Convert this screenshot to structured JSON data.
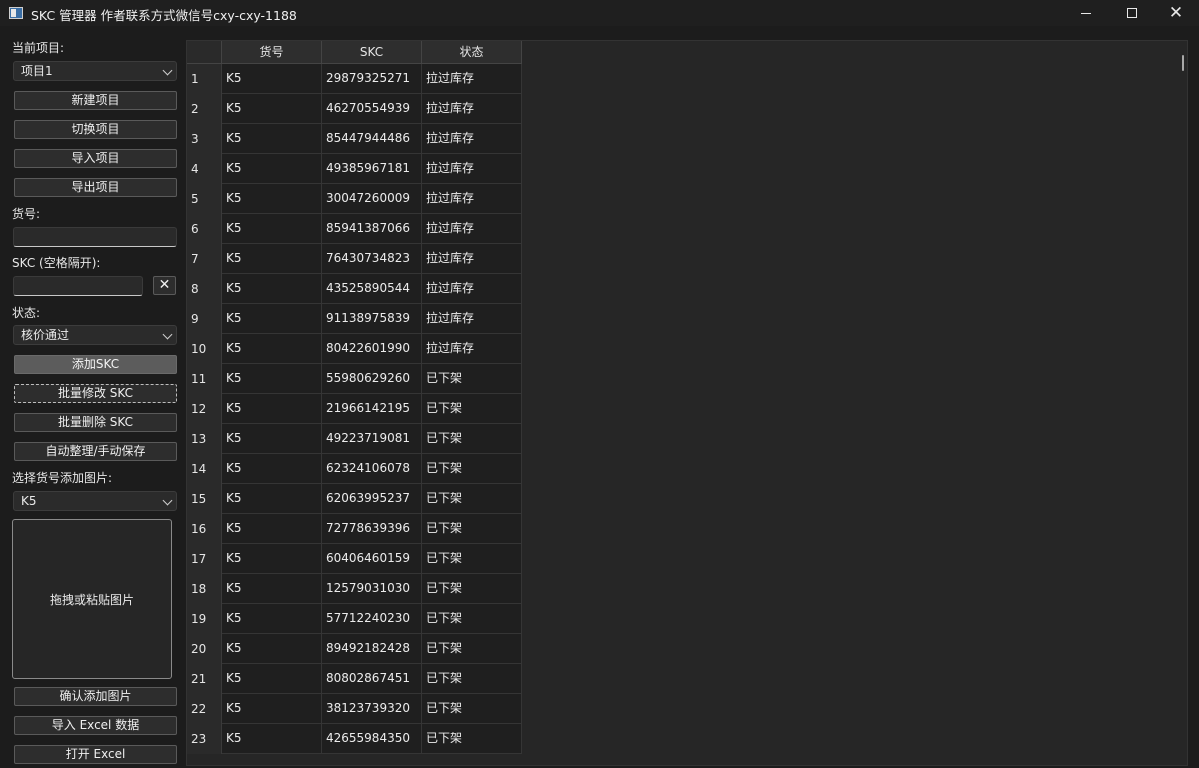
{
  "window": {
    "title": "SKC 管理器 作者联系方式微信号cxy-cxy-1188",
    "min_icon": "minimize-icon",
    "max_icon": "maximize-icon",
    "close_label": "✕"
  },
  "left": {
    "current_project_label": "当前项目:",
    "current_project_value": "项目1",
    "buttons": {
      "new_project": "新建项目",
      "switch_project": "切换项目",
      "import_project": "导入项目",
      "export_project": "导出项目"
    },
    "sku_label": "货号:",
    "sku_value": "",
    "skc_label": "SKC (空格隔开):",
    "skc_value": "",
    "clear_label": "✕",
    "status_label": "状态:",
    "status_value": "核价通过",
    "actions": {
      "add_skc": "添加SKC",
      "batch_modify": "批量修改 SKC",
      "batch_delete": "批量删除 SKC",
      "auto_organize": "自动整理/手动保存"
    },
    "image_sku_label": "选择货号添加图片:",
    "image_sku_value": "K5",
    "dropzone_text": "拖拽或粘贴图片",
    "bottom": {
      "confirm_image": "确认添加图片",
      "import_excel": "导入 Excel 数据",
      "open_excel": "打开 Excel"
    }
  },
  "table": {
    "columns": [
      "货号",
      "SKC",
      "状态"
    ],
    "rows": [
      {
        "n": "1",
        "sku": "K5",
        "skc": "29879325271",
        "status": "拉过库存"
      },
      {
        "n": "2",
        "sku": "K5",
        "skc": "46270554939",
        "status": "拉过库存"
      },
      {
        "n": "3",
        "sku": "K5",
        "skc": "85447944486",
        "status": "拉过库存"
      },
      {
        "n": "4",
        "sku": "K5",
        "skc": "49385967181",
        "status": "拉过库存"
      },
      {
        "n": "5",
        "sku": "K5",
        "skc": "30047260009",
        "status": "拉过库存"
      },
      {
        "n": "6",
        "sku": "K5",
        "skc": "85941387066",
        "status": "拉过库存"
      },
      {
        "n": "7",
        "sku": "K5",
        "skc": "76430734823",
        "status": "拉过库存"
      },
      {
        "n": "8",
        "sku": "K5",
        "skc": "43525890544",
        "status": "拉过库存"
      },
      {
        "n": "9",
        "sku": "K5",
        "skc": "91138975839",
        "status": "拉过库存"
      },
      {
        "n": "10",
        "sku": "K5",
        "skc": "80422601990",
        "status": "拉过库存"
      },
      {
        "n": "11",
        "sku": "K5",
        "skc": "55980629260",
        "status": "已下架"
      },
      {
        "n": "12",
        "sku": "K5",
        "skc": "21966142195",
        "status": "已下架"
      },
      {
        "n": "13",
        "sku": "K5",
        "skc": "49223719081",
        "status": "已下架"
      },
      {
        "n": "14",
        "sku": "K5",
        "skc": "62324106078",
        "status": "已下架"
      },
      {
        "n": "15",
        "sku": "K5",
        "skc": "62063995237",
        "status": "已下架"
      },
      {
        "n": "16",
        "sku": "K5",
        "skc": "72778639396",
        "status": "已下架"
      },
      {
        "n": "17",
        "sku": "K5",
        "skc": "60406460159",
        "status": "已下架"
      },
      {
        "n": "18",
        "sku": "K5",
        "skc": "12579031030",
        "status": "已下架"
      },
      {
        "n": "19",
        "sku": "K5",
        "skc": "57712240230",
        "status": "已下架"
      },
      {
        "n": "20",
        "sku": "K5",
        "skc": "89492182428",
        "status": "已下架"
      },
      {
        "n": "21",
        "sku": "K5",
        "skc": "80802867451",
        "status": "已下架"
      },
      {
        "n": "22",
        "sku": "K5",
        "skc": "38123739320",
        "status": "已下架"
      },
      {
        "n": "23",
        "sku": "K5",
        "skc": "42655984350",
        "status": "已下架"
      }
    ]
  }
}
